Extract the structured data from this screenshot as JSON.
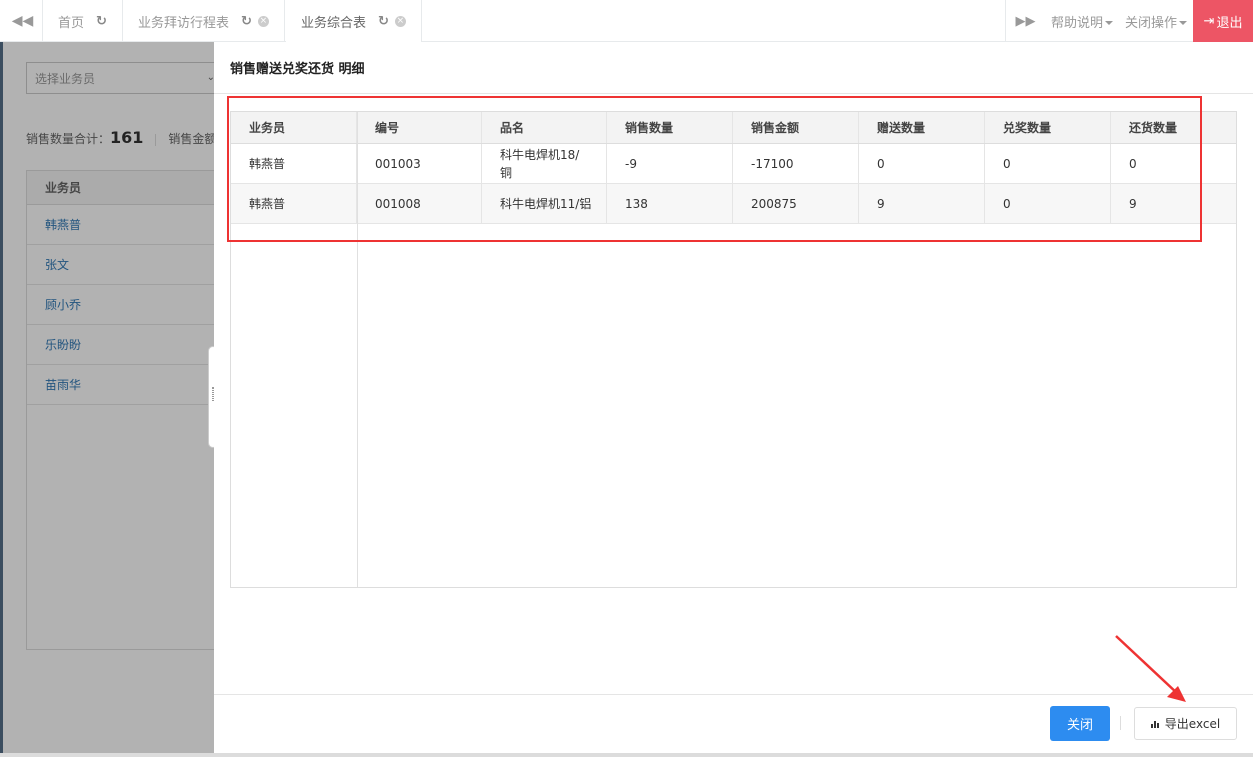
{
  "topbar": {
    "back_icon": "double-chevron-left-icon",
    "tabs": [
      {
        "label": "首页",
        "icon": "refresh-icon"
      },
      {
        "label": "业务拜访行程表",
        "icon": "refresh-icon"
      },
      {
        "label": "业务综合表",
        "icon": "refresh-icon",
        "active": true
      }
    ],
    "forward_icon": "double-chevron-right-icon",
    "help_label": "帮助说明",
    "close_ops_label": "关闭操作",
    "logout_label": "退出",
    "logout_color": "#ed5565"
  },
  "background": {
    "select_placeholder": "选择业务员",
    "summary_label": "销售数量合计：",
    "summary_value": "161",
    "summary_label2": "销售金额",
    "list_header": "业务员",
    "list_items": [
      "韩燕普",
      "张文",
      "顾小乔",
      "乐盼盼",
      "苗雨华"
    ]
  },
  "drawer": {
    "title": "销售赠送兑奖还货 明细",
    "columns": [
      "业务员",
      "编号",
      "品名",
      "销售数量",
      "销售金额",
      "赠送数量",
      "兑奖数量",
      "还货数量"
    ],
    "rows": [
      {
        "salesman": "韩燕普",
        "code": "001003",
        "product": "科牛电焊机18/铜",
        "sales_qty": "-9",
        "sales_amount": "-17100",
        "gift_qty": "0",
        "prize_qty": "0",
        "return_qty": "0"
      },
      {
        "salesman": "韩燕普",
        "code": "001008",
        "product": "科牛电焊机11/铝",
        "sales_qty": "138",
        "sales_amount": "200875",
        "gift_qty": "9",
        "prize_qty": "0",
        "return_qty": "9"
      }
    ],
    "close_button": "关闭",
    "export_button": "导出excel",
    "primary_color": "#2d8cf0",
    "highlight_color": "#ee3333"
  }
}
